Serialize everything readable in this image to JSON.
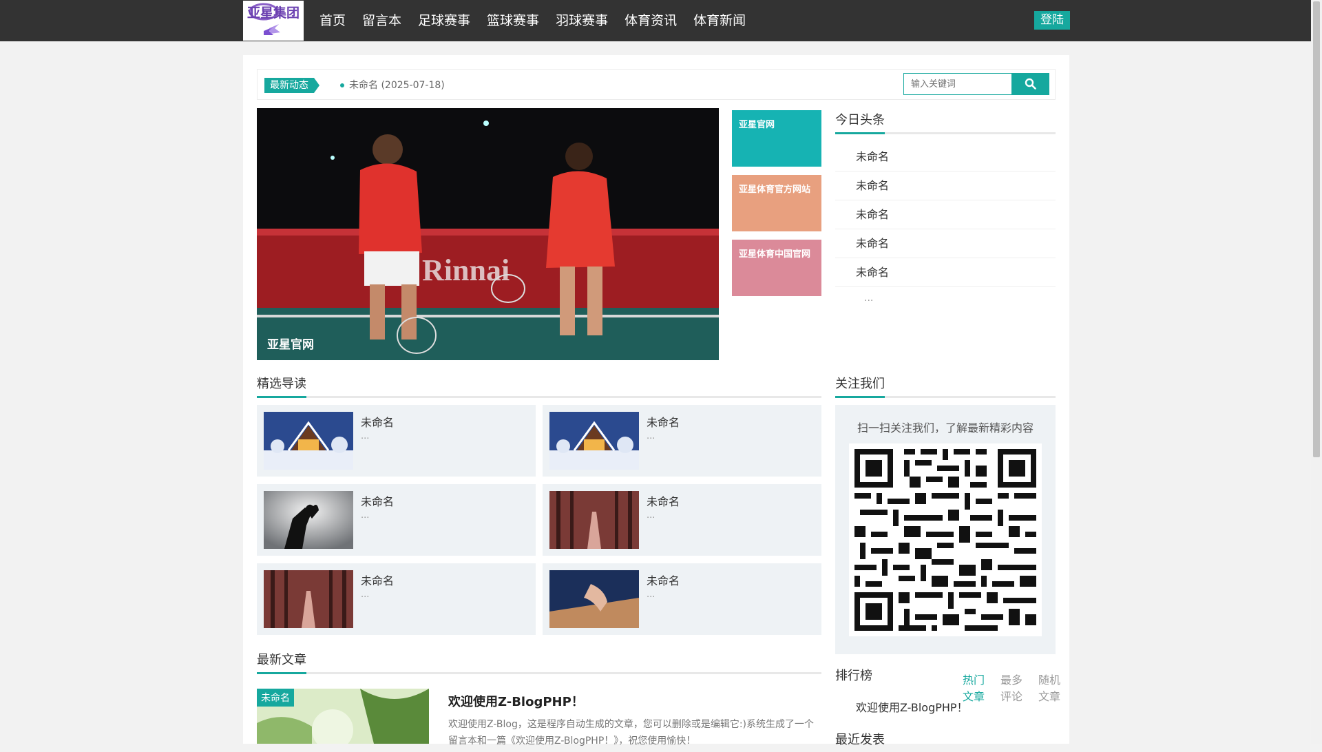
{
  "header": {
    "logo_text": "亚星集团",
    "nav": [
      "首页",
      "留言本",
      "足球赛事",
      "篮球赛事",
      "羽球赛事",
      "体育资讯",
      "体育新闻"
    ],
    "login_label": "登陆"
  },
  "ticker": {
    "tag": "最新动态",
    "item": "未命名 (2025-07-18)"
  },
  "search": {
    "placeholder": "输入关键词"
  },
  "banner": {
    "caption": "亚星官网"
  },
  "tiles": [
    "亚星官网",
    "亚星体育官方网站",
    "亚星体育中国官网"
  ],
  "headlines": {
    "title": "今日头条",
    "items": [
      "未命名",
      "未命名",
      "未命名",
      "未命名",
      "未命名"
    ],
    "more": "..."
  },
  "featured": {
    "title": "精选导读",
    "items": [
      {
        "title": "未命名",
        "excerpt": "..."
      },
      {
        "title": "未命名",
        "excerpt": "..."
      },
      {
        "title": "未命名",
        "excerpt": "..."
      },
      {
        "title": "未命名",
        "excerpt": "..."
      },
      {
        "title": "未命名",
        "excerpt": "..."
      },
      {
        "title": "未命名",
        "excerpt": "..."
      }
    ]
  },
  "latest": {
    "title": "最新文章",
    "badge": "未命名",
    "article_title": "欢迎使用Z-BlogPHP！",
    "excerpt": "欢迎使用Z-Blog，这是程序自动生成的文章，您可以删除或是编辑它:)系统生成了一个留言本和一篇《欢迎使用Z-BlogPHP！》，祝您使用愉快！"
  },
  "follow": {
    "title": "关注我们",
    "text": "扫一扫关注我们，了解最新精彩内容"
  },
  "ranking": {
    "title": "排行榜",
    "tabs": [
      "热门文章",
      "最多评论",
      "随机文章"
    ],
    "items": [
      "欢迎使用Z-BlogPHP！"
    ]
  },
  "recent": {
    "title": "最近发表"
  },
  "colors": {
    "accent": "#16a89e",
    "topbar": "#333333",
    "tile1": "#16b3b3",
    "tile2": "#e8a07f",
    "tile3": "#db8a99"
  }
}
